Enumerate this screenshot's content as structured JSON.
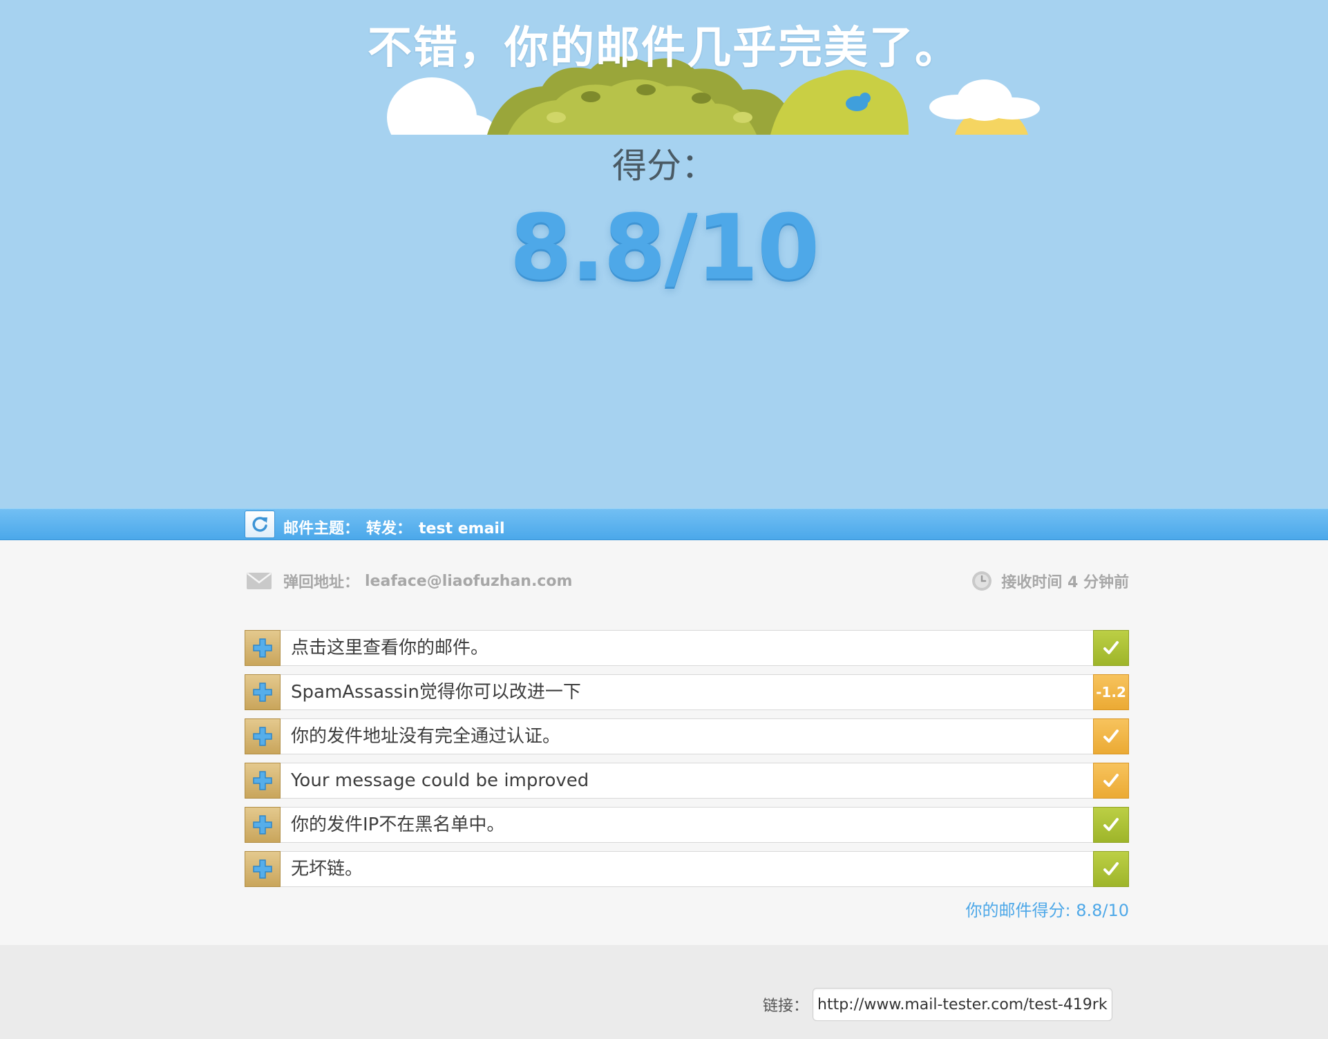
{
  "hero": {
    "headline": "不错，你的邮件几乎完美了。",
    "score_label": "得分：",
    "score_value": "8.8/10"
  },
  "subject_bar": {
    "refresh_icon": "refresh-icon",
    "subject_label": "邮件主题：",
    "subject_prefix": "转发：",
    "subject_value": "test email"
  },
  "info": {
    "envelope_icon": "envelope-icon",
    "bounce_label": "弹回地址：",
    "bounce_value": "leaface@liaofuzhan.com",
    "clock_icon": "clock-icon",
    "received_label": "接收时间 4 分钟前"
  },
  "results": [
    {
      "label": "点击这里查看你的邮件。",
      "status": "check",
      "badge": "",
      "color": "#a9bf33"
    },
    {
      "label": "SpamAssassin觉得你可以改进一下",
      "status": "score",
      "badge": "-1.2",
      "color": "#f0b43f"
    },
    {
      "label": "你的发件地址没有完全通过认证。",
      "status": "check",
      "badge": "",
      "color": "#f0b43f"
    },
    {
      "label": "Your message could be improved",
      "status": "check",
      "badge": "",
      "color": "#f0b43f"
    },
    {
      "label": "你的发件IP不在黑名单中。",
      "status": "check",
      "badge": "",
      "color": "#a9bf33"
    },
    {
      "label": "无坏链。",
      "status": "check",
      "badge": "",
      "color": "#a9bf33"
    }
  ],
  "total": "你的邮件得分: 8.8/10",
  "footer": {
    "link_label": "链接：",
    "link_value": "http://www.mail-tester.com/test-419rk"
  },
  "colors": {
    "sky": "#a6d2f0",
    "accent_blue": "#4ea8e8",
    "green_badge": "#a9bf33",
    "orange_badge": "#f0b43f"
  }
}
